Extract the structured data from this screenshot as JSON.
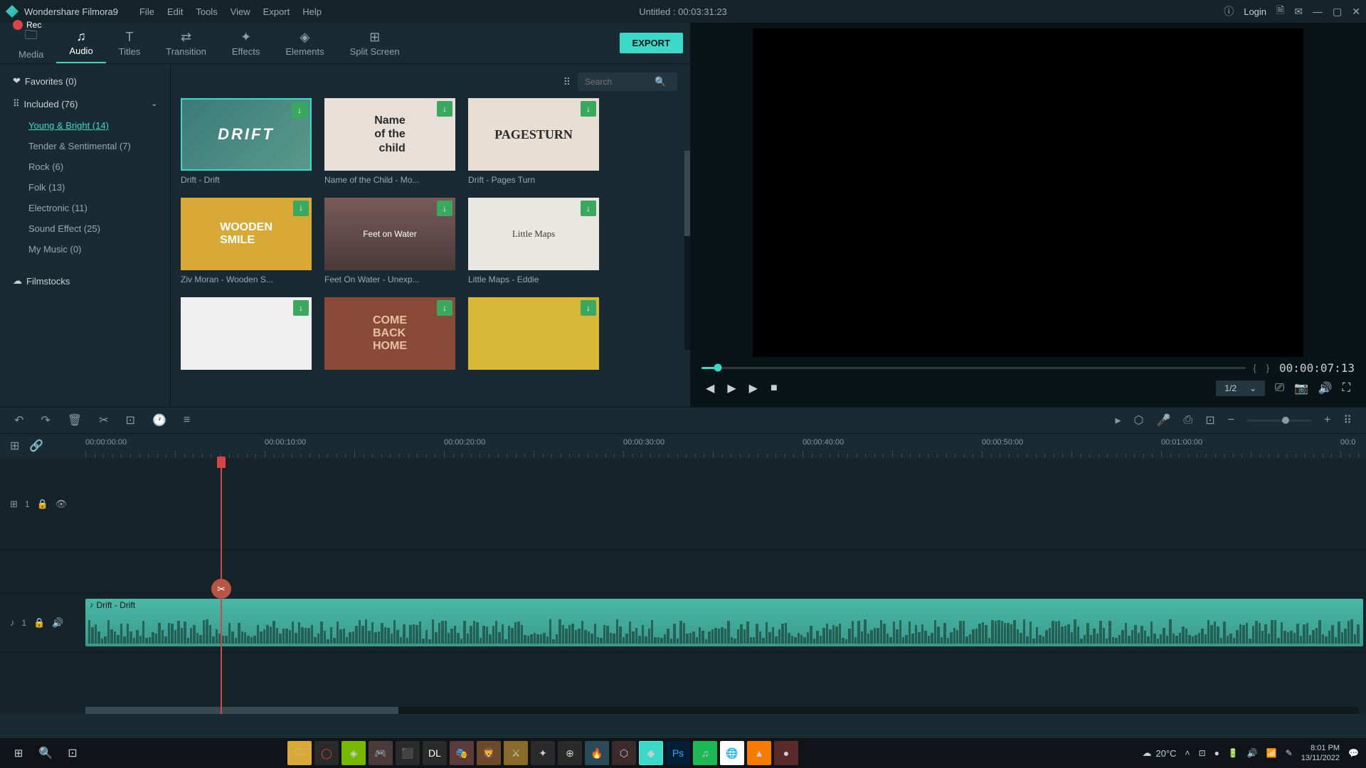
{
  "app": {
    "title": "Wondershare Filmora9",
    "rec": "Rec",
    "project_title": "Untitled : 00:03:31:23",
    "login": "Login"
  },
  "menu": {
    "file": "File",
    "edit": "Edit",
    "tools": "Tools",
    "view": "View",
    "export": "Export",
    "help": "Help"
  },
  "tabs": {
    "media": "Media",
    "audio": "Audio",
    "titles": "Titles",
    "transition": "Transition",
    "effects": "Effects",
    "elements": "Elements",
    "split": "Split Screen",
    "export_btn": "EXPORT"
  },
  "sidebar": {
    "favorites": "Favorites (0)",
    "included": "Included (76)",
    "items": [
      {
        "label": "Young & Bright (14)"
      },
      {
        "label": "Tender & Sentimental (7)"
      },
      {
        "label": "Rock (6)"
      },
      {
        "label": "Folk (13)"
      },
      {
        "label": "Electronic (11)"
      },
      {
        "label": "Sound Effect (25)"
      },
      {
        "label": "My Music (0)"
      }
    ],
    "filmstocks": "Filmstocks"
  },
  "search": {
    "placeholder": "Search"
  },
  "cards": [
    {
      "label": "Drift - Drift"
    },
    {
      "label": "Name of the Child - Mo..."
    },
    {
      "label": "Drift - Pages Turn"
    },
    {
      "label": "Ziv Moran - Wooden S..."
    },
    {
      "label": "Feet On Water - Unexp..."
    },
    {
      "label": "Little Maps - Eddie"
    }
  ],
  "preview": {
    "timecode": "00:00:07:13",
    "scale": "1/2"
  },
  "ruler": [
    "00:00:00:00",
    "00:00:10:00",
    "00:00:20:00",
    "00:00:30:00",
    "00:00:40:00",
    "00:00:50:00",
    "00:01:00:00",
    "00:0"
  ],
  "tracks": {
    "video": "1",
    "audio": "1",
    "clip": "Drift - Drift"
  },
  "taskbar": {
    "temp": "20°C",
    "time": "8:01 PM",
    "date": "13/11/2022"
  }
}
